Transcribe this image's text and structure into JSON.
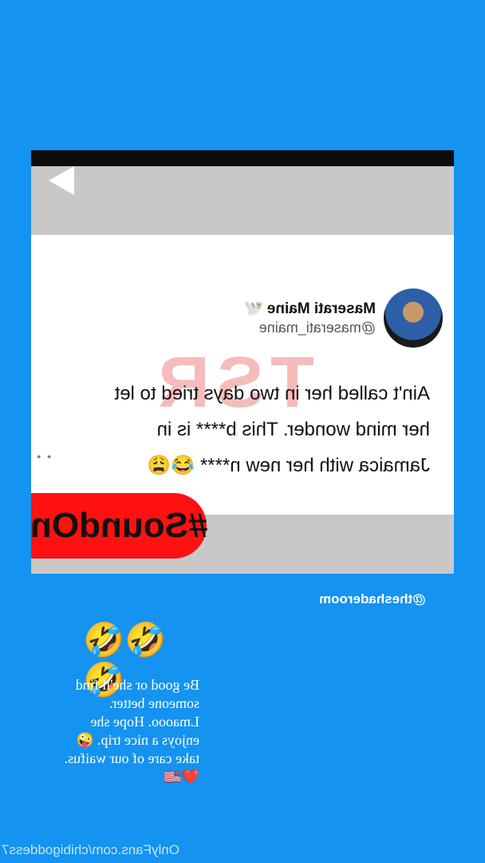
{
  "video": {
    "tweet": {
      "name": "Maserati Maine",
      "bird_icon": "dove-emoji",
      "handle": "@maserati_maine",
      "lines": [
        "Ain't called her in two days tried to let",
        "her mind wonder. This b**** is in",
        "Jamaica with her new n**** 😂😩"
      ],
      "watermark": "TSR",
      "more_dots": "• •"
    },
    "sound_tag": "#SoundOn"
  },
  "source_handle": "@theshaderoom",
  "reaction_emoji": "🤣🤣🤣",
  "caption": [
    "Be good or she'll find",
    "someone better.",
    "Lmaooo. Hope she",
    "enjoys a nice trip. 🤪",
    "take care of our waifus.",
    "❤️🇺🇸"
  ],
  "footer_text": "OnlyFans.com/chibigoddess7",
  "colors": {
    "background": "#1493f0",
    "badge": "#ff1111"
  }
}
